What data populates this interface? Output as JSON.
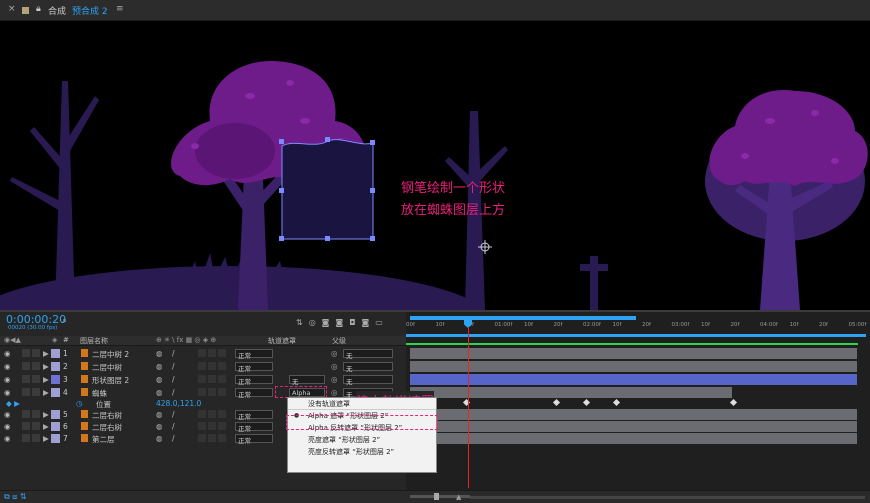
{
  "tabbar": {
    "close_glyph": "×",
    "comp_label": "合成",
    "tab_label": "预合成 2",
    "menu_glyph": "≡"
  },
  "annotation": {
    "line1": "钢笔绘制一个形状",
    "line2": "放在蜘蛛图层上方",
    "color": "#e8207a"
  },
  "annotation2": {
    "text": "建立轨道遮罩"
  },
  "timecode": {
    "value": "0:00:00:20",
    "fps": "00020 (30.00 fps)"
  },
  "headers": {
    "hash": "#",
    "layer_name": "图层名称",
    "track_matte": "轨道遮罩",
    "parent": "父级"
  },
  "layers": [
    {
      "num": "1",
      "name": "二层中树 2",
      "mode": "正常",
      "matte": "",
      "parent": "无",
      "color": "#a0a0d0"
    },
    {
      "num": "2",
      "name": "二层中树",
      "mode": "正常",
      "matte": "",
      "parent": "无",
      "color": "#a0a0d0"
    },
    {
      "num": "3",
      "name": "形状图层 2",
      "mode": "正常",
      "matte": "无",
      "parent": "无",
      "color": "#7070d0"
    },
    {
      "num": "4",
      "name": "蜘蛛",
      "mode": "正常",
      "matte": "Alpha",
      "parent": "无",
      "color": "#a0a0d0"
    }
  ],
  "property": {
    "name": "位置",
    "value": "428.0,121.0"
  },
  "layers_lower": [
    {
      "num": "5",
      "name": "二层右树",
      "mode": "正常",
      "parent": "无",
      "color": "#a0a0d0"
    },
    {
      "num": "6",
      "name": "二层右树",
      "mode": "正常",
      "parent": "无",
      "color": "#a0a0d0"
    },
    {
      "num": "7",
      "name": "第二层",
      "mode": "正常",
      "parent": "无",
      "color": "#a0a0d0"
    }
  ],
  "matte_menu": {
    "items": [
      "没有轨道遮罩",
      "Alpha 遮罩 “形状图层 2”",
      "Alpha 反转遮罩 “形状图层 2”",
      "亮度遮罩 “形状图层 2”",
      "亮度反转遮罩 “形状图层 2”"
    ],
    "selected": 1
  },
  "ruler": [
    "00f",
    "10f",
    "20f",
    "01:00f",
    "10f",
    "20f",
    "02:00f",
    "10f",
    "20f",
    "03:00f",
    "10f",
    "20f",
    "04:00f",
    "10f",
    "20f",
    "05:00f"
  ],
  "colors": {
    "accent": "#2ea3f2",
    "playhead": "#e22",
    "purple_cap": "#6d1c8a",
    "tree": "#3b2268"
  }
}
